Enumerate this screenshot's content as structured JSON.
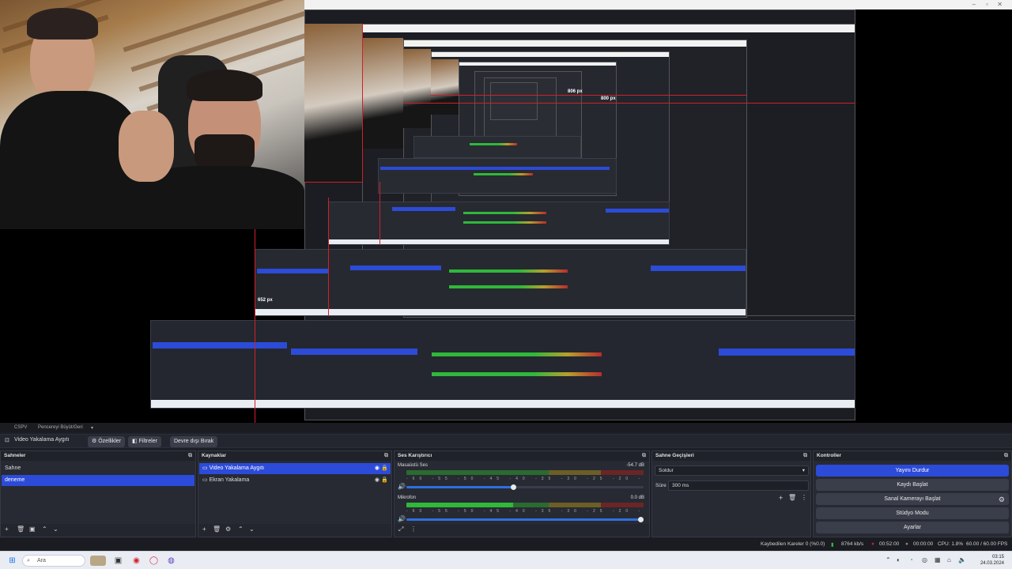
{
  "preview": {
    "nested_labels": [
      "806 px",
      "800 px",
      "652 px"
    ]
  },
  "menubar": {
    "items": [
      "CSPV",
      "Pencereyi Büyüt/Geri"
    ]
  },
  "toolbar": {
    "source_name": "Video Yakalama Aygıtı",
    "properties_label": "Özellikler",
    "filters_label": "Filtreler",
    "deactivate_label": "Devre dışı Bırak"
  },
  "scenes": {
    "title": "Sahneler",
    "items": [
      "Sahne",
      "deneme"
    ],
    "selected_index": 1
  },
  "sources": {
    "title": "Kaynaklar",
    "items": [
      "Video Yakalama Aygıtı",
      "Ekran Yakalama"
    ],
    "selected_index": 0
  },
  "mixer": {
    "title": "Ses Karıştırıcı",
    "channels": [
      {
        "name": "Masaüstü Ses",
        "db": "-54.7 dB",
        "volume": 0.45
      },
      {
        "name": "Mikrofon",
        "db": "0.0 dB",
        "volume": 1.0
      }
    ],
    "ticks": "-60 -55 -50 -45 -40 -35 -30 -25 -20 -15 -10 -5 0"
  },
  "transitions": {
    "title": "Sahne Geçişleri",
    "transition_value": "Soldur",
    "duration_label": "Süre",
    "duration_value": "300 ms"
  },
  "controls": {
    "title": "Kontroller",
    "buttons": [
      "Yayını Durdur",
      "Kaydı Başlat",
      "Sanal Kamerayı Başlat",
      "Stüdyo Modu",
      "Ayarlar"
    ],
    "active_index": 0
  },
  "status": {
    "dropped_frames": "Kaybedilen Kareler 0 (%0.0)",
    "bitrate": "8764 kb/s",
    "stream_time": "00:52:00",
    "record_time": "00:00:00",
    "cpu": "CPU: 1.8%",
    "fps": "60.00 / 60.00 FPS"
  },
  "taskbar": {
    "search_placeholder": "Ara",
    "time": "03:15",
    "date": "24.03.2024"
  },
  "colors": {
    "accent": "#2c4bd8",
    "meter_green": "#2fb83a",
    "meter_yellow": "#b8a02c",
    "meter_red": "#b82c2c",
    "live_red": "#d0202a"
  }
}
